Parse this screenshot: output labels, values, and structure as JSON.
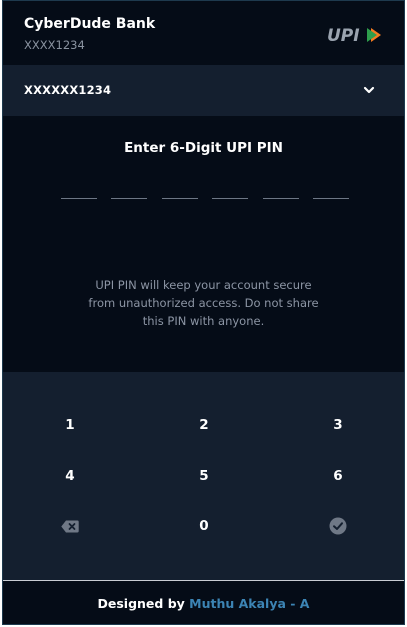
{
  "header": {
    "bank_name": "CyberDude Bank",
    "masked_account": "XXXX1234",
    "logo_text": "UPI"
  },
  "account_selector": {
    "selected": "XXXXXX1234",
    "icon": "chevron-down-icon"
  },
  "pin": {
    "title": "Enter 6-Digit UPI PIN",
    "digits_entered": 0,
    "digits_total": 6,
    "info": "UPI PIN will keep your account secure from unauthorized access. Do not share this PIN with anyone."
  },
  "keypad": {
    "keys": [
      "1",
      "2",
      "3",
      "4",
      "5",
      "6",
      "0"
    ],
    "backspace_icon": "backspace-icon",
    "submit_icon": "check-circle-icon"
  },
  "footer": {
    "prefix": "Designed by",
    "author": "Muthu Akalya - A"
  },
  "colors": {
    "background": "#050c17",
    "panel": "#141f2f",
    "accent": "#3c84b4",
    "muted_text": "#8c95a4",
    "logo_orange": "#f47b20",
    "logo_green": "#2e9e4c"
  }
}
